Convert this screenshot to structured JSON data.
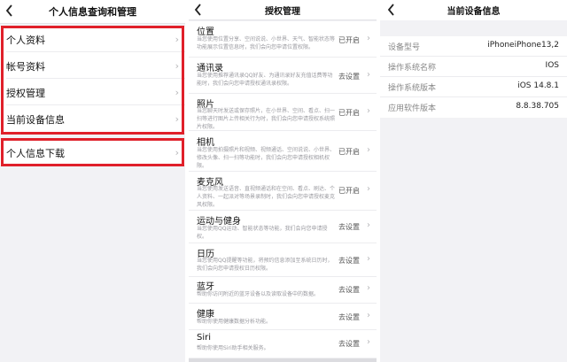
{
  "panel1": {
    "title": "个人信息查询和管理",
    "items": [
      {
        "label": "个人资料"
      },
      {
        "label": "帐号资料"
      },
      {
        "label": "授权管理"
      },
      {
        "label": "当前设备信息"
      }
    ],
    "download": {
      "label": "个人信息下载"
    },
    "highlight_color": "#e0202a"
  },
  "panel2": {
    "title": "授权管理",
    "items": [
      {
        "title": "位置",
        "desc": "当您使用位置分享、空间说说、小世界、天气、智能状态等功能展示位置信息时，我们会向您申请位置权限。",
        "status": "已开启"
      },
      {
        "title": "通讯录",
        "desc": "当您使用推荐通讯录QQ好友、为通讯录好友充值话费等功能时，我们会向您申请授权通讯录权限。",
        "status": "去设置"
      },
      {
        "title": "照片",
        "desc": "当您聊天时发送或保存照片，在小世界、空间、看点、扫一扫等进行图片上传相关行为时，我们会向您申请授权系统照片权限。",
        "status": "已开启"
      },
      {
        "title": "相机",
        "desc": "当您使用拍摄照片和视频、视频通话、空间说说、小世界、修改头像、扫一扫等功能时，我们会向您申请授权相机权限。",
        "status": "已开启"
      },
      {
        "title": "麦克风",
        "desc": "当您使用发送语音、直视频通话和在空间、看点、刷达、个人资料、一起派对等场景录制时，我们会向您申请授权麦克风权限。",
        "status": "已开启"
      },
      {
        "title": "运动与健身",
        "desc": "当您使用QQ运动、智能状态等功能，我们会向您申请授权。",
        "status": "去设置"
      },
      {
        "title": "日历",
        "desc": "当您使用QQ提醒等功能，将预约信息添加至系统日历时，我们会向您申请授权日历权限。",
        "status": "去设置"
      },
      {
        "title": "蓝牙",
        "desc": "帮助你访问附近的蓝牙设备以及读取设备中的数据。",
        "status": "去设置"
      },
      {
        "title": "健康",
        "desc": "帮助你使用健康数据分析功能。",
        "status": "去设置"
      },
      {
        "title": "Siri",
        "desc": "帮助你使用Siri助手相关服务。",
        "status": "去设置"
      }
    ]
  },
  "panel3": {
    "title": "当前设备信息",
    "rows": [
      {
        "key": "设备型号",
        "value": "iPhoneiPhone13,2"
      },
      {
        "key": "操作系统名称",
        "value": "IOS"
      },
      {
        "key": "操作系统版本",
        "value": "iOS 14.8.1"
      },
      {
        "key": "应用软件版本",
        "value": "8.8.38.705"
      }
    ]
  },
  "icons": {
    "back": "chevron-left-icon",
    "forward": "chevron-right-icon"
  }
}
